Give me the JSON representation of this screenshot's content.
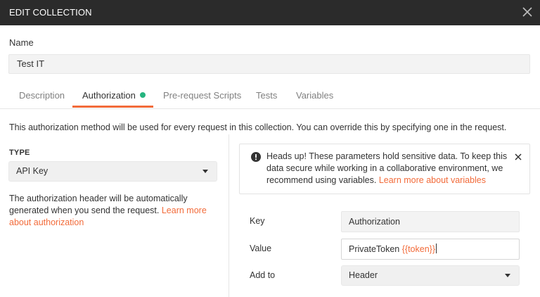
{
  "window": {
    "title": "EDIT COLLECTION",
    "close_icon": "close-icon"
  },
  "name": {
    "label": "Name",
    "value": "Test IT"
  },
  "tabs": [
    {
      "label": "Description",
      "active": false
    },
    {
      "label": "Authorization",
      "active": true,
      "status_dot_color": "#26b47f"
    },
    {
      "label": "Pre-request Scripts",
      "active": false
    },
    {
      "label": "Tests",
      "active": false
    },
    {
      "label": "Variables",
      "active": false
    }
  ],
  "accent_color": "#f26b3a",
  "auth": {
    "description": "This authorization method will be used for every request in this collection. You can override this by specifying one in the request.",
    "type_label": "TYPE",
    "type_value": "API Key",
    "help_text": "The authorization header will be automatically generated when you send the request.",
    "help_link": "Learn more about authorization"
  },
  "alert": {
    "icon": "warning-icon",
    "message": "Heads up! These parameters hold sensitive data. To keep this data secure while working in a collaborative environment, we recommend using variables.",
    "link": "Learn more about variables"
  },
  "fields": {
    "key_label": "Key",
    "key_value": "Authorization",
    "value_label": "Value",
    "value_prefix": "PrivateToken ",
    "value_variable": "{{token}}",
    "add_to_label": "Add to",
    "add_to_value": "Header"
  }
}
